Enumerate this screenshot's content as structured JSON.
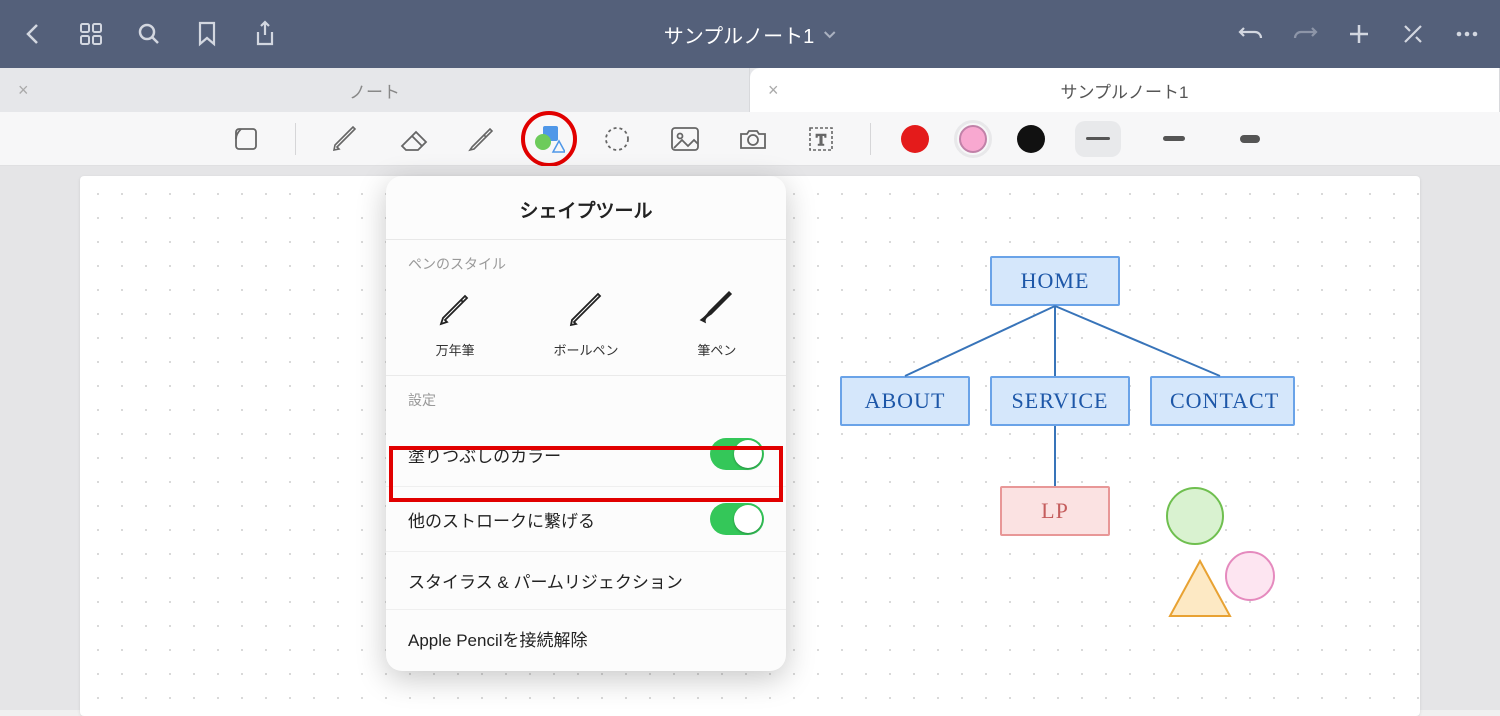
{
  "topbar": {
    "title": "サンプルノート1"
  },
  "tabs": [
    {
      "label": "ノート",
      "active": false
    },
    {
      "label": "サンプルノート1",
      "active": true
    }
  ],
  "popover": {
    "title": "シェイプツール",
    "pen_style_section": "ペンのスタイル",
    "pen_styles": [
      "万年筆",
      "ボールペン",
      "筆ペン"
    ],
    "settings_section": "設定",
    "rows": {
      "fill_color": {
        "label": "塗りつぶしのカラー",
        "on": true,
        "highlighted": true
      },
      "connect_strokes": {
        "label": "他のストロークに繋げる",
        "on": true
      },
      "stylus_palm": {
        "label": "スタイラス & パームリジェクション"
      },
      "disconnect_pencil": {
        "label": "Apple Pencilを接続解除"
      }
    }
  },
  "diagram": {
    "boxes": {
      "home": "HOME",
      "about": "ABOUT",
      "service": "SERVICE",
      "contact": "CONTACT",
      "lp": "LP"
    }
  },
  "colors": {
    "accent_red": "#e41b1b",
    "accent_pink": "#f8a8d0",
    "accent_black": "#111"
  }
}
